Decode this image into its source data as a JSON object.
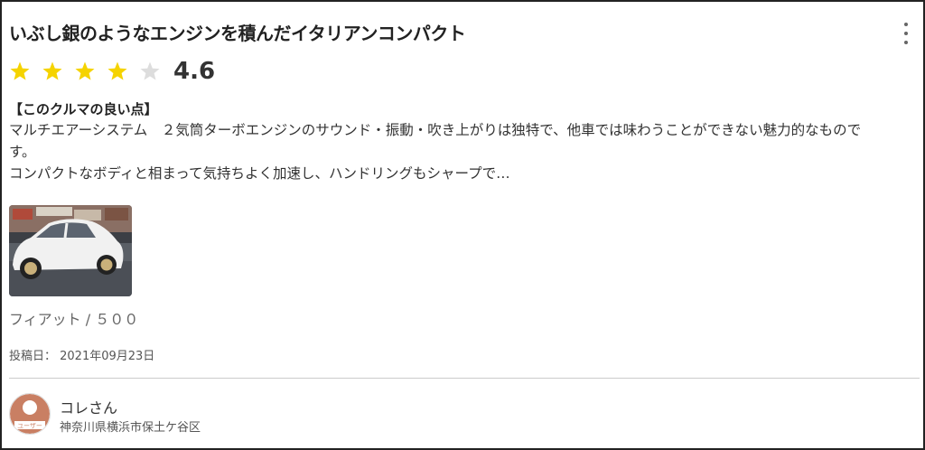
{
  "review": {
    "title": "いぶし銀のようなエンジンを積んだイタリアンコンパクト",
    "rating": 4.6,
    "rating_display": "4.6",
    "stars_filled": 4,
    "stars_total": 5,
    "good_points_label": "【このクルマの良い点】",
    "body_line1": "マルチエアーシステム　２気筒ターボエンジンのサウンド・振動・吹き上がりは独特で、他車では味わうことができない魅力的なものです。",
    "body_line2": "コンパクトなボディと相まって気持ちよく加速し、ハンドリングもシャープで…",
    "car_name": "フィアット / ５００",
    "posted_date": "投稿日： 2021年09月23日"
  },
  "author": {
    "name": "コレさん",
    "location": "神奈川県横浜市保土ケ谷区",
    "avatar_label": "ユーザー"
  },
  "icons": {
    "menu": "more-vertical-icon",
    "star_filled": "star-filled-icon",
    "star_empty": "star-empty-icon"
  },
  "colors": {
    "star_filled": "#f5d300",
    "star_empty": "#dddddd",
    "avatar_bg": "#c97f63",
    "border": "#222222",
    "divider": "#cccccc"
  }
}
